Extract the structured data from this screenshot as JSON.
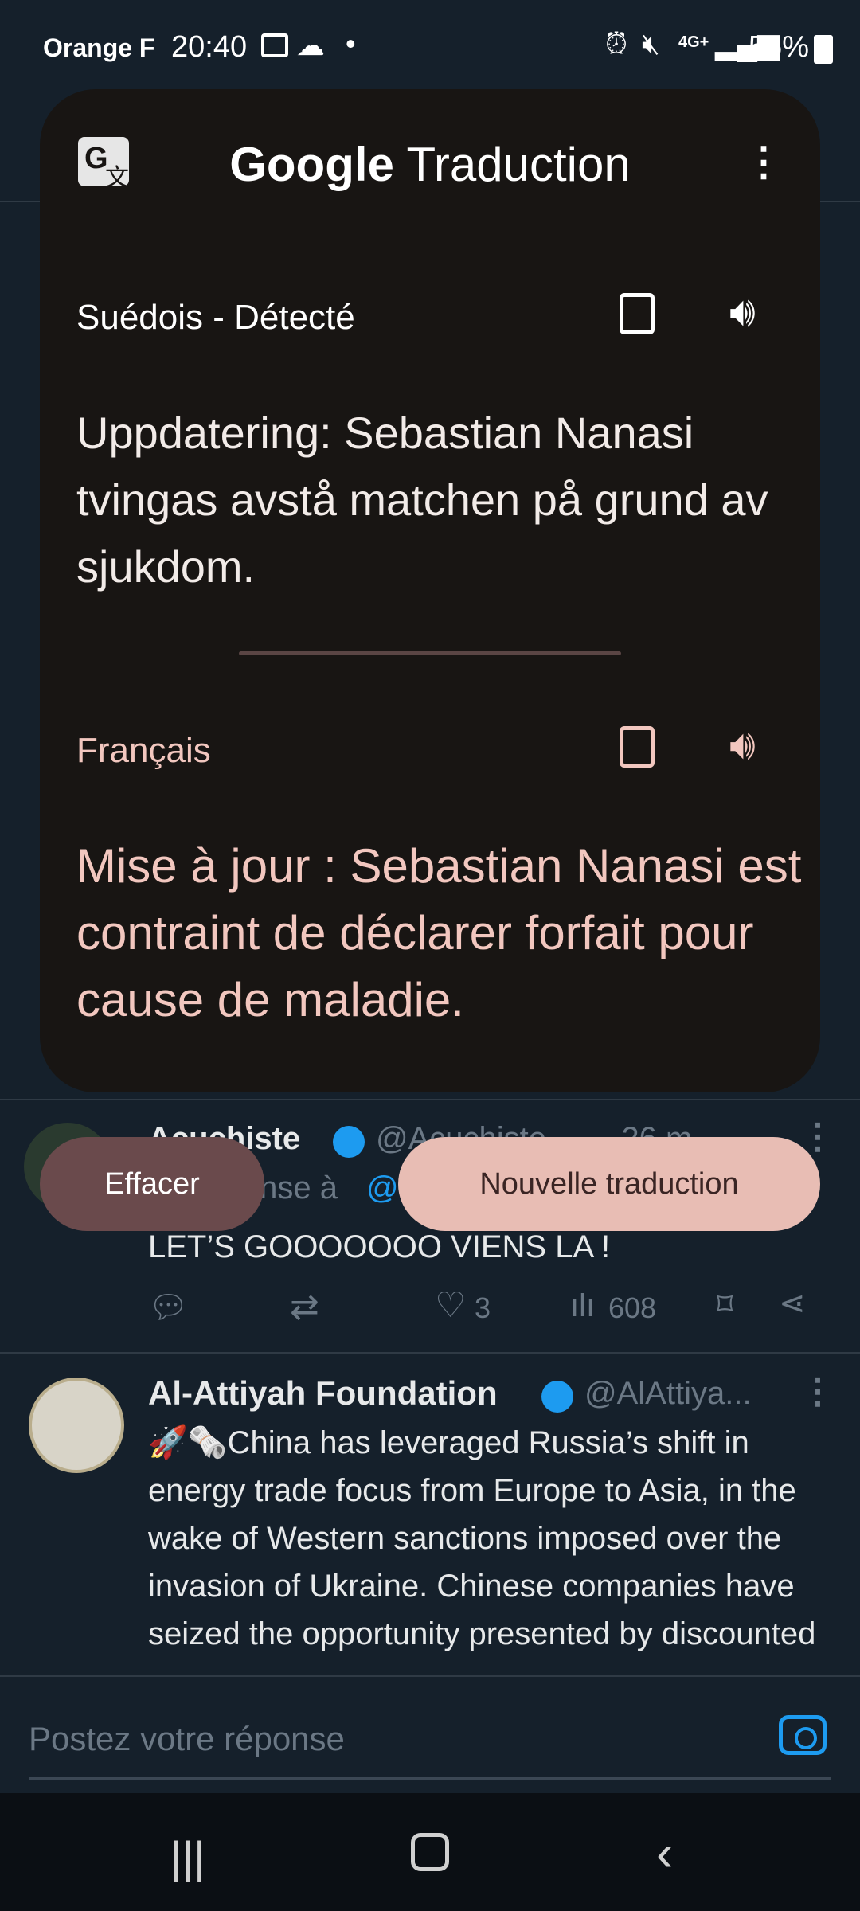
{
  "status_bar": {
    "carrier": "Orange F",
    "time": "20:40",
    "network": "4G+",
    "battery": "56%"
  },
  "translate": {
    "app_title_brand": "Google",
    "app_title_word": "Traduction",
    "source_language": "Suédois - Détecté",
    "source_text": " Uppdatering: Sebastian Nanasi tvingas avstå matchen på grund av sjukdom.",
    "target_language": "Français",
    "target_text": "Mise à jour : Sebastian Nanasi est contraint de déclarer forfait pour cause de maladie.",
    "clear_button": "Effacer",
    "new_translation_button": "Nouvelle traduction"
  },
  "tweets": [
    {
      "author": "Acuchiste",
      "handle": "@Acuchiste",
      "time": "· 26 m",
      "reply_to_prefix": "En réponse à",
      "reply_to_handle": "@",
      "text": "LET’S GOOOOOOO VIENS LA !",
      "likes": "3",
      "views": "608"
    },
    {
      "author": "Al-Attiyah Foundation",
      "handle": "@AlAttiya...",
      "text": "🚀🗞️China has leveraged Russia’s shift in energy trade focus from Europe to Asia, in the wake of Western sanctions imposed over the invasion of Ukraine. Chinese companies have seized the opportunity presented by discounted"
    }
  ],
  "reply_box": {
    "placeholder": "Postez votre réponse"
  },
  "colors": {
    "background": "#15202b",
    "card": "#181513",
    "accent_pink": "#e8bdb4",
    "clear_button": "#6a4a4c",
    "twitter_blue": "#1d9bf0"
  }
}
